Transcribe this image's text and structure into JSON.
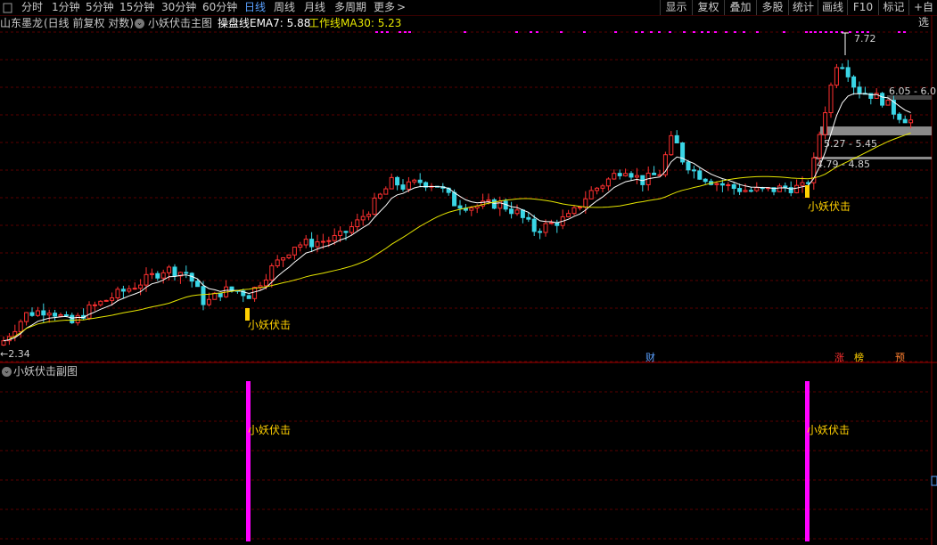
{
  "toolbar": {
    "left_icon": "square-icon",
    "periods": [
      {
        "label": "分时",
        "active": false
      },
      {
        "label": "1分钟",
        "active": false
      },
      {
        "label": "5分钟",
        "active": false
      },
      {
        "label": "15分钟",
        "active": false
      },
      {
        "label": "30分钟",
        "active": false
      },
      {
        "label": "60分钟",
        "active": false
      },
      {
        "label": "日线",
        "active": true
      },
      {
        "label": "周线",
        "active": false
      },
      {
        "label": "月线",
        "active": false
      },
      {
        "label": "多周期",
        "active": false
      },
      {
        "label": "更多",
        "active": false
      }
    ],
    "more_arrow": ">",
    "right_buttons": [
      "显示",
      "复权",
      "叠加",
      "多股",
      "统计",
      "画线",
      "F10",
      "标记",
      "+自选"
    ]
  },
  "main_chart": {
    "stock_name": "山东墨龙",
    "mode": "(日线 前复权 对数)",
    "indicator_name": "小妖伏击主图",
    "ema_label": "操盘线EMA7: 5.88",
    "ma_label": "工作线MA30: 5.23",
    "signal_label": "小妖伏击",
    "low_label": "←2.34",
    "high_label": "7.72",
    "zones": [
      {
        "label": "6.05 - 6.0",
        "low": 6.0,
        "high": 6.05
      },
      {
        "label": "5.27 - 5.45",
        "low": 5.27,
        "high": 5.45
      },
      {
        "label": "4.79 - 4.85",
        "low": 4.79,
        "high": 4.85
      }
    ],
    "events": [
      {
        "label": "财",
        "color": "#5aa0ff"
      },
      {
        "label": "涨",
        "color": "#ff3030"
      },
      {
        "label": "榜",
        "color": "#ffd000"
      },
      {
        "label": "预",
        "color": "#ff8030"
      }
    ],
    "colors": {
      "up": "#ff3030",
      "down": "#3ad6e6",
      "ema": "#ffffff",
      "ma": "#e6e600",
      "signal": "#ffd000",
      "grid": "#5a0000",
      "dots": "#ff00ff"
    }
  },
  "sub_chart": {
    "indicator_name": "小妖伏击副图",
    "signal_label": "小妖伏击",
    "bar_color": "#ff00ff"
  }
}
